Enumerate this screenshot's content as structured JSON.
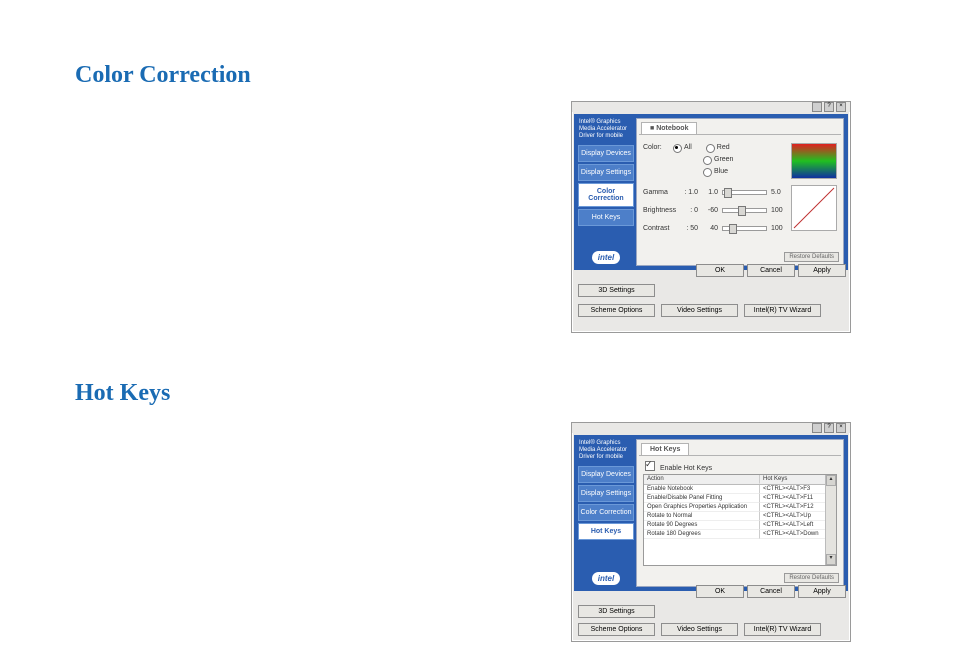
{
  "headings": {
    "color_correction": "Color Correction",
    "hot_keys": "Hot Keys"
  },
  "common": {
    "brand_lines": "Intel®\nGraphics Media\nAccelerator Driver\nfor mobile",
    "logo_text": "intel",
    "nav": {
      "display_devices": "Display Devices",
      "display_settings": "Display Settings",
      "color_correction": "Color Correction",
      "hot_keys": "Hot Keys"
    },
    "dlg": {
      "ok": "OK",
      "cancel": "Cancel",
      "apply": "Apply"
    },
    "bottom": {
      "3d": "3D Settings",
      "scheme": "Scheme Options",
      "video": "Video Settings",
      "tv": "Intel(R) TV Wizard"
    },
    "restore_defaults": "Restore Defaults"
  },
  "cc": {
    "tab": "Notebook",
    "labels": {
      "color": "Color:",
      "all": "All",
      "red": "Red",
      "green": "Green",
      "blue": "Blue",
      "gamma": "Gamma",
      "brightness": "Brightness",
      "contrast": "Contrast"
    },
    "values": {
      "gamma_cur": "1.0",
      "gamma_min": "1.0",
      "gamma_max": "5.0",
      "bright_cur": "0",
      "bright_min": "-60",
      "bright_max": "100",
      "contrast_cur": "50",
      "contrast_min": "40",
      "contrast_max": "100"
    }
  },
  "hk": {
    "tab": "Hot Keys",
    "enable": "Enable Hot Keys",
    "cols": {
      "action": "Action",
      "hotkeys": "Hot Keys"
    },
    "rows": [
      {
        "a": "Enable Notebook",
        "k": "<CTRL><ALT>F3"
      },
      {
        "a": "Enable/Disable Panel Fitting",
        "k": "<CTRL><ALT>F11"
      },
      {
        "a": "Open Graphics Properties Application",
        "k": "<CTRL><ALT>F12"
      },
      {
        "a": "Rotate to Normal",
        "k": "<CTRL><ALT>Up"
      },
      {
        "a": "Rotate 90 Degrees",
        "k": "<CTRL><ALT>Left"
      },
      {
        "a": "Rotate 180 Degrees",
        "k": "<CTRL><ALT>Down"
      }
    ]
  }
}
